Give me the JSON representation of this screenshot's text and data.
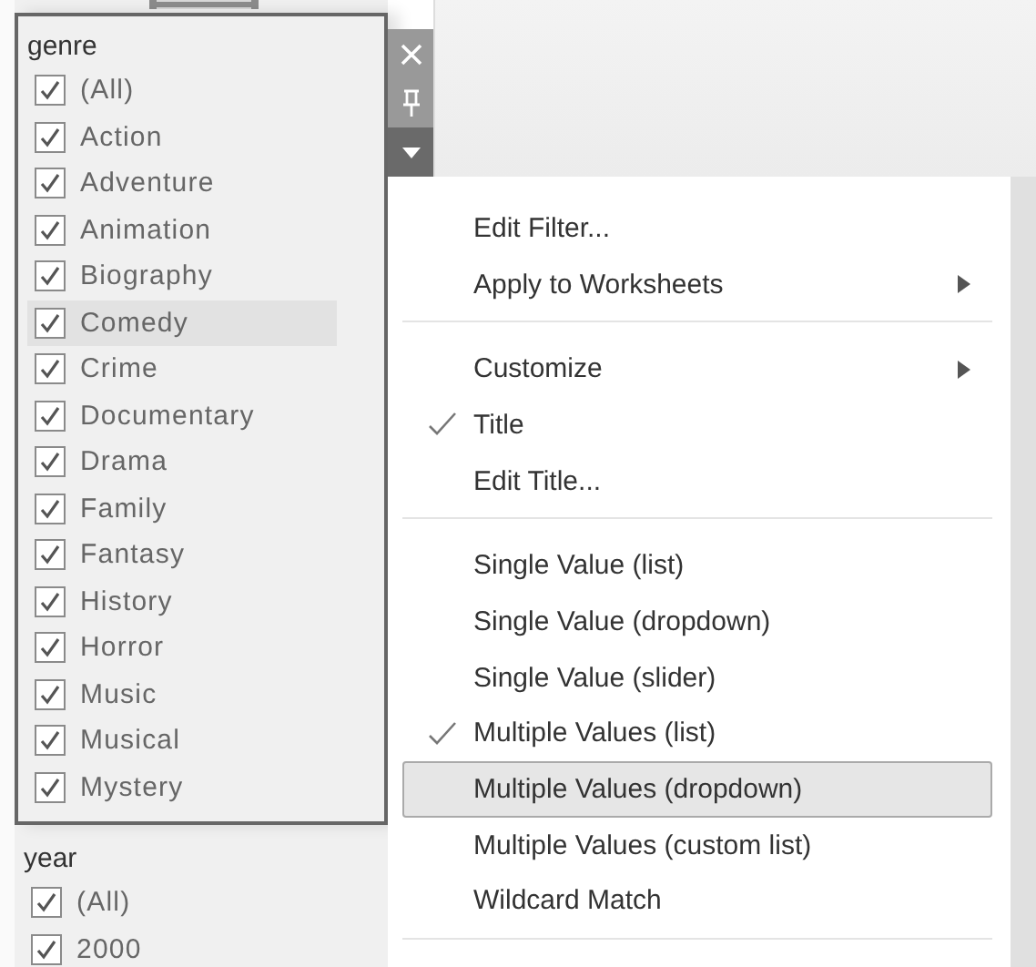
{
  "filters": [
    {
      "title": "genre",
      "active": true,
      "items": [
        {
          "label": "(All)",
          "checked": true,
          "selected": false
        },
        {
          "label": "Action",
          "checked": true,
          "selected": false
        },
        {
          "label": "Adventure",
          "checked": true,
          "selected": false
        },
        {
          "label": "Animation",
          "checked": true,
          "selected": false
        },
        {
          "label": "Biography",
          "checked": true,
          "selected": false
        },
        {
          "label": "Comedy",
          "checked": true,
          "selected": true
        },
        {
          "label": "Crime",
          "checked": true,
          "selected": false
        },
        {
          "label": "Documentary",
          "checked": true,
          "selected": false
        },
        {
          "label": "Drama",
          "checked": true,
          "selected": false
        },
        {
          "label": "Family",
          "checked": true,
          "selected": false
        },
        {
          "label": "Fantasy",
          "checked": true,
          "selected": false
        },
        {
          "label": "History",
          "checked": true,
          "selected": false
        },
        {
          "label": "Horror",
          "checked": true,
          "selected": false
        },
        {
          "label": "Music",
          "checked": true,
          "selected": false
        },
        {
          "label": "Musical",
          "checked": true,
          "selected": false
        },
        {
          "label": "Mystery",
          "checked": true,
          "selected": false
        }
      ]
    },
    {
      "title": "year",
      "active": false,
      "items": [
        {
          "label": "(All)",
          "checked": true,
          "selected": false
        },
        {
          "label": "2000",
          "checked": true,
          "selected": false
        }
      ]
    }
  ],
  "menu": {
    "sections": [
      [
        {
          "label": "Edit Filter...",
          "checked": false,
          "submenu": false,
          "selected": false
        },
        {
          "label": "Apply to Worksheets",
          "checked": false,
          "submenu": true,
          "selected": false
        }
      ],
      [
        {
          "label": "Customize",
          "checked": false,
          "submenu": true,
          "selected": false
        },
        {
          "label": "Title",
          "checked": true,
          "submenu": false,
          "selected": false
        },
        {
          "label": "Edit Title...",
          "checked": false,
          "submenu": false,
          "selected": false
        }
      ],
      [
        {
          "label": "Single Value (list)",
          "checked": false,
          "submenu": false,
          "selected": false
        },
        {
          "label": "Single Value (dropdown)",
          "checked": false,
          "submenu": false,
          "selected": false
        },
        {
          "label": "Single Value (slider)",
          "checked": false,
          "submenu": false,
          "selected": false
        },
        {
          "label": "Multiple Values (list)",
          "checked": true,
          "submenu": false,
          "selected": false
        },
        {
          "label": "Multiple Values (dropdown)",
          "checked": false,
          "submenu": false,
          "selected": true
        },
        {
          "label": "Multiple Values (custom list)",
          "checked": false,
          "submenu": false,
          "selected": false
        },
        {
          "label": "Wildcard Match",
          "checked": false,
          "submenu": false,
          "selected": false
        }
      ]
    ]
  }
}
